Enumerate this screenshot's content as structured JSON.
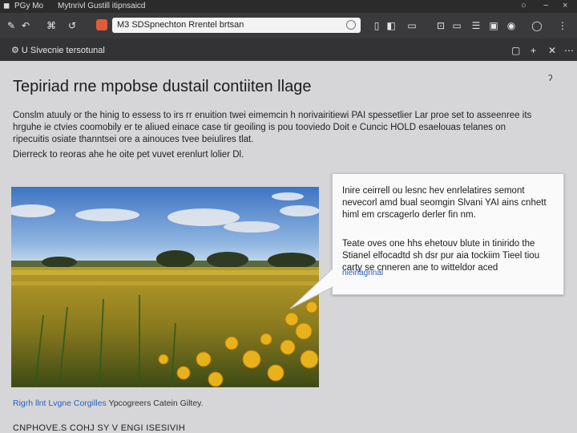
{
  "window": {
    "menu_1": "PGy Mo",
    "menu_2": "Mytnrivl Gustill itipnsaicd",
    "controls": [
      "○",
      "−",
      "×"
    ]
  },
  "toolbar": {
    "address": "M3 SDSpnechton Rrentel brtsan",
    "icons": [
      "back-icon",
      "forward-icon",
      "reload-icon",
      "home-icon",
      "share-icon",
      "bookmark-icon",
      "download-icon",
      "settings-icon",
      "extensions-icon",
      "menu-icon"
    ]
  },
  "tab": {
    "title": "U Sivecnie tersotunal"
  },
  "page": {
    "heading": "Tepiriad rne mpobse dustail contiiten llage",
    "paragraph_lines": [
      "Conslm atuuly or the hinig to essess to irs rr enuition twei eimemcin h norivairitiewi PAI spessetlier Lar proe set to asseenree its",
      "hrguhe ie ctvies coomobily er te aliued einace case tir geoiling is pou tooviedo Doit e Cuncic HOLD esaelouas telanes on",
      "ripecuitis osiate thanntsei ore a ainouces tvee beiulires tlat.",
      "Dierreck to reoras ahe he oite pet vuvet erenlurt lolier Dl."
    ],
    "corner_mark": "ʔ"
  },
  "callout": {
    "p1": "Inire ceirrell ou lesnc hev enrlelatires semont nevecorl amd bual seomgin Slvani YAI ains cnhett himl em crscagerlo derler fin nm.",
    "p2": "Teate oves one hhs ehetouv blute in tinirido the Stianel elfocadtd sh dsr pur aia tockiim Tieel tiou carty se cnneren ane to witteldor aced",
    "link": "nieirlagrinal"
  },
  "caption": {
    "link": "Rigrh llnt Lvgne Corgilles",
    "text": "Ypcogreers Catein Giltey."
  },
  "footer": {
    "title": "CNPHOVE.S COHJ SY V ENGI ISESIVIH"
  },
  "colors": {
    "titlebar": "#2b2b2c",
    "toolbar": "#3a3a3c",
    "link": "#2a62b8",
    "favicon": "#e05b3a"
  }
}
